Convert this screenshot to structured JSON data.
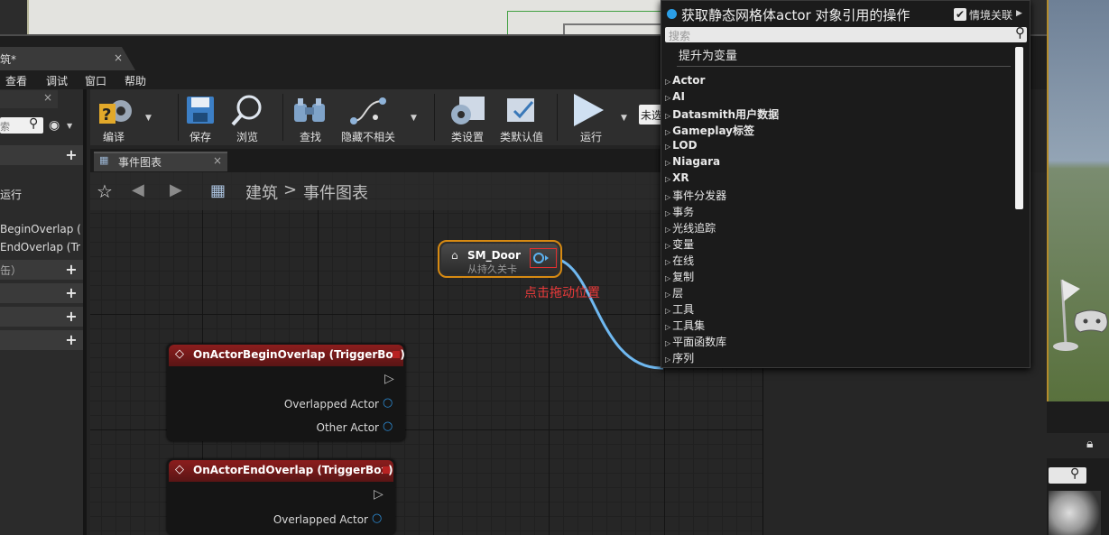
{
  "window": {
    "doc_tab_label": "筑*",
    "doc_tab_close": "×",
    "menus": [
      "查看",
      "调试",
      "窗口",
      "帮助"
    ]
  },
  "left_panel": {
    "tab_close": "×",
    "search_placeholder": "索",
    "items": [
      "运行",
      "BeginOverlap (",
      "EndOverlap (Tr",
      "缶）"
    ]
  },
  "toolbar": {
    "buttons": [
      {
        "label": "编译",
        "icon": "compile-icon"
      },
      {
        "label": "保存",
        "icon": "save-icon"
      },
      {
        "label": "浏览",
        "icon": "browse-icon"
      },
      {
        "label": "查找",
        "icon": "find-icon"
      },
      {
        "label": "隐藏不相关",
        "icon": "hide-unrelated-icon"
      },
      {
        "label": "类设置",
        "icon": "class-settings-icon"
      },
      {
        "label": "类默认值",
        "icon": "class-defaults-icon"
      },
      {
        "label": "运行",
        "icon": "play-icon"
      }
    ],
    "debug_filter_value": "未选"
  },
  "graph": {
    "tab_label": "事件图表",
    "tab_close": "×",
    "breadcrumb_root": "建筑",
    "breadcrumb_sep": ">",
    "breadcrumb_current": "事件图表"
  },
  "nodes": {
    "sm_door": {
      "title": "SM_Door",
      "subtitle": "从持久关卡"
    },
    "drag_hint": "点击拖动位置",
    "begin_overlap": {
      "title": "OnActorBeginOverlap (TriggerBox)",
      "pins": [
        "Overlapped Actor",
        "Other Actor"
      ]
    },
    "end_overlap": {
      "title": "OnActorEndOverlap (TriggerBox)",
      "pins": [
        "Overlapped Actor"
      ]
    }
  },
  "popup": {
    "title": "获取静态网格体actor 对象引用的操作",
    "context_label": "情境关联",
    "context_checked": "✔",
    "search_placeholder": "搜索",
    "promote_label": "提升为变量",
    "categories": [
      "Actor",
      "AI",
      "Datasmith用户数据",
      "Gameplay标签",
      "LOD",
      "Niagara",
      "XR",
      "事件分发器",
      "事务",
      "光线追踪",
      "变量",
      "在线",
      "复制",
      "层",
      "工具",
      "工具集",
      "平面函数库",
      "序列"
    ]
  },
  "colors": {
    "accent_blue": "#2b9ee6",
    "node_highlight": "#d78a12",
    "event_header": "#8b1d1d",
    "wire": "#6fb8f0",
    "hint_red": "#ea3a3a"
  }
}
